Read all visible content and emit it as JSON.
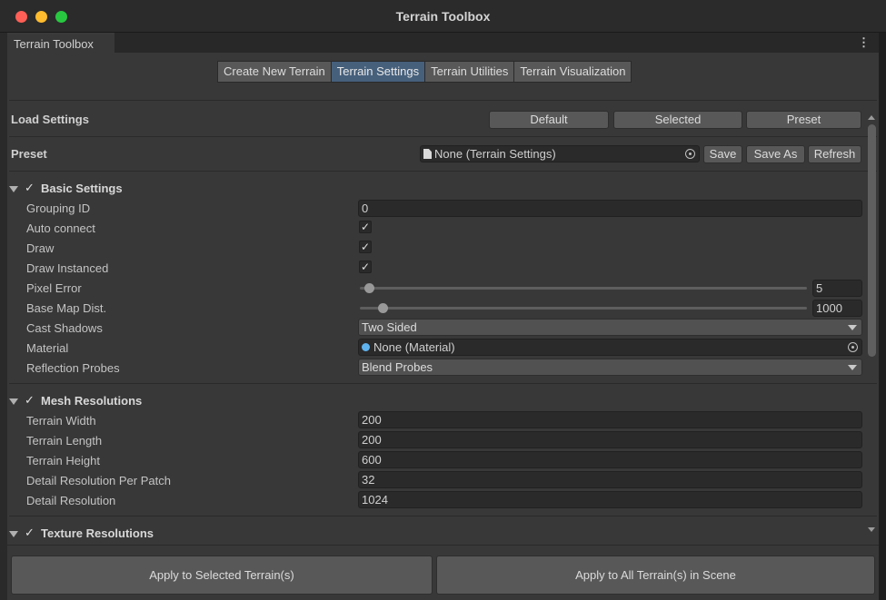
{
  "window": {
    "title": "Terrain Toolbox"
  },
  "tab": {
    "label": "Terrain Toolbox",
    "menu_icon": "⋮"
  },
  "modes": [
    {
      "label": "Create New Terrain",
      "active": false
    },
    {
      "label": "Terrain Settings",
      "active": true
    },
    {
      "label": "Terrain Utilities",
      "active": false
    },
    {
      "label": "Terrain Visualization",
      "active": false
    }
  ],
  "load_settings": {
    "label": "Load Settings",
    "buttons": [
      "Default",
      "Selected",
      "Preset"
    ]
  },
  "preset": {
    "label": "Preset",
    "value": "None (Terrain Settings)",
    "buttons": [
      "Save",
      "Save As",
      "Refresh"
    ]
  },
  "basic_settings": {
    "title": "Basic Settings",
    "enabled": "✓",
    "grouping_id": {
      "label": "Grouping ID",
      "value": "0"
    },
    "auto_connect": {
      "label": "Auto connect",
      "checked": "✓"
    },
    "draw": {
      "label": "Draw",
      "checked": "✓"
    },
    "draw_instanced": {
      "label": "Draw Instanced",
      "checked": "✓"
    },
    "pixel_error": {
      "label": "Pixel Error",
      "value": "5",
      "fraction": 0.02
    },
    "base_map_dist": {
      "label": "Base Map Dist.",
      "value": "1000",
      "fraction": 0.05
    },
    "cast_shadows": {
      "label": "Cast Shadows",
      "value": "Two Sided"
    },
    "material": {
      "label": "Material",
      "value": "None (Material)"
    },
    "reflection_probes": {
      "label": "Reflection Probes",
      "value": "Blend Probes"
    }
  },
  "mesh_resolutions": {
    "title": "Mesh Resolutions",
    "enabled": "✓",
    "terrain_width": {
      "label": "Terrain Width",
      "value": "200"
    },
    "terrain_length": {
      "label": "Terrain Length",
      "value": "200"
    },
    "terrain_height": {
      "label": "Terrain Height",
      "value": "600"
    },
    "detail_res_per_patch": {
      "label": "Detail Resolution Per Patch",
      "value": "32"
    },
    "detail_resolution": {
      "label": "Detail Resolution",
      "value": "1024"
    }
  },
  "texture_resolutions": {
    "title": "Texture Resolutions",
    "enabled": "✓"
  },
  "footer": {
    "apply_selected": "Apply to Selected Terrain(s)",
    "apply_all": "Apply to All Terrain(s) in Scene"
  },
  "colors": {
    "active_tab": "#46607c",
    "button": "#585858",
    "panel": "#383838"
  }
}
